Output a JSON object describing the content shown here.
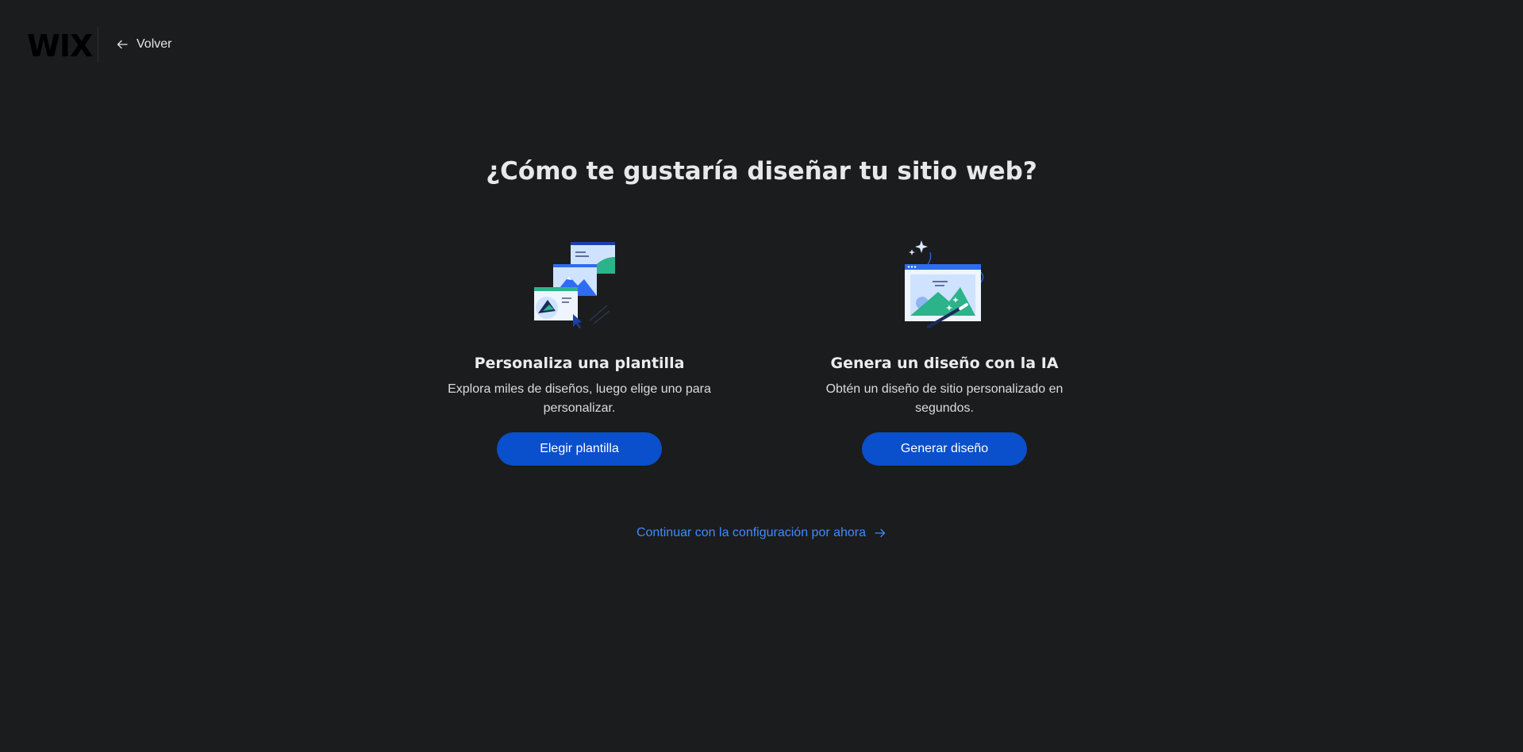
{
  "header": {
    "logo_text": "WIX",
    "back_label": "Volver",
    "back_icon": "arrow-left-icon"
  },
  "main": {
    "title": "¿Cómo te gustaría diseñar tu sitio web?",
    "options": [
      {
        "icon": "templates-illustration",
        "title": "Personaliza una plantilla",
        "description": "Explora miles de diseños, luego elige uno para personalizar.",
        "button_label": "Elegir plantilla"
      },
      {
        "icon": "ai-design-illustration",
        "title": "Genera un diseño con la IA",
        "description": "Obtén un diseño de sitio personalizado en segundos.",
        "button_label": "Generar diseño"
      }
    ],
    "continue_label": "Continuar con la configuración por ahora",
    "continue_icon": "arrow-right-icon"
  },
  "colors": {
    "background": "#1b1c1e",
    "button": "#0a4fcc",
    "link": "#3c8cff",
    "illustration_blue": "#2e6cf0",
    "illustration_green": "#2bb38a"
  }
}
